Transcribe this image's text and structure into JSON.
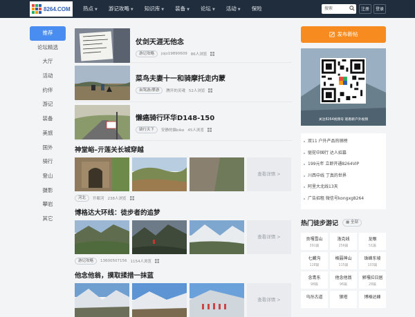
{
  "header": {
    "logo_text": "8264.COM",
    "nav": [
      {
        "label": "热点",
        "caret": true
      },
      {
        "label": "游记攻略",
        "caret": true
      },
      {
        "label": "知识库",
        "caret": true
      },
      {
        "label": "装备",
        "caret": true
      },
      {
        "label": "论坛",
        "caret": true
      },
      {
        "label": "活动",
        "caret": true
      },
      {
        "label": "保险",
        "caret": false
      }
    ],
    "search_placeholder": "搜索",
    "register_label": "注册",
    "login_label": "登录"
  },
  "sidebar": {
    "items": [
      "推荐",
      "论坛精选",
      "大厅",
      "活动",
      "约伴",
      "游记",
      "装备",
      "美旅",
      "国外",
      "骑行",
      "登山",
      "摄影",
      "攀岩",
      "其它"
    ]
  },
  "articles": [
    {
      "title": "仗剑天涯无他念",
      "tag": "游记攻略",
      "author": "jojo19890609",
      "views": "86人浏览"
    },
    {
      "title": "菜鸟夫妻十一和骑摩托走内蒙",
      "tag": "自驾游/摩游",
      "author": "腾开的灵魂",
      "views": "52人浏览"
    },
    {
      "title": "懒癌骑行环华D148-150",
      "tag": "骑行天下",
      "author": "安静的猫bike",
      "views": "45人浏览"
    }
  ],
  "galleries": [
    {
      "title": "神堂峪–亓莲关长城穿越",
      "tag": "河北",
      "author": "开都河",
      "views": "238人浏览",
      "more": "查看详情 >"
    },
    {
      "title": "博格达大环线：徒步者的追梦",
      "tag": "游记攻略",
      "author": "13600507156",
      "views": "1154人浏览",
      "more": "查看详情 >"
    },
    {
      "title": "他念他翁，摸取揉措一抹蓝",
      "more": "查看详情 >"
    }
  ],
  "right": {
    "post_label": "发布新帖",
    "qr_caption": "关注8264视频号   观看新户外视频",
    "links": [
      "双11 户外产品热销榜",
      "驱驼中国行 达人招募",
      "199元年 立即开通8264VIP",
      "川西中线 丁真的世界",
      "阿里大北线13天",
      "广告招租 微信号kongxg8264"
    ],
    "hot_title": "热门徒步游记",
    "hot_all": "全部",
    "hot": [
      {
        "name": "贡嘎雪山",
        "count": "391篇"
      },
      {
        "name": "洛克线",
        "count": "256篇"
      },
      {
        "name": "龙眼",
        "count": "51篇"
      },
      {
        "name": "七藏沟",
        "count": "128篇"
      },
      {
        "name": "格聂神山",
        "count": "115篇"
      },
      {
        "name": "珠峰东坡",
        "count": "103篇"
      },
      {
        "name": "念青东",
        "count": "98篇"
      },
      {
        "name": "他念他翁",
        "count": "96篇"
      },
      {
        "name": "郭嘎拉日居",
        "count": "28篇"
      },
      {
        "name": "乌孙古道",
        "count": ""
      },
      {
        "name": "狼塔",
        "count": ""
      },
      {
        "name": "博格达峰",
        "count": ""
      }
    ]
  }
}
